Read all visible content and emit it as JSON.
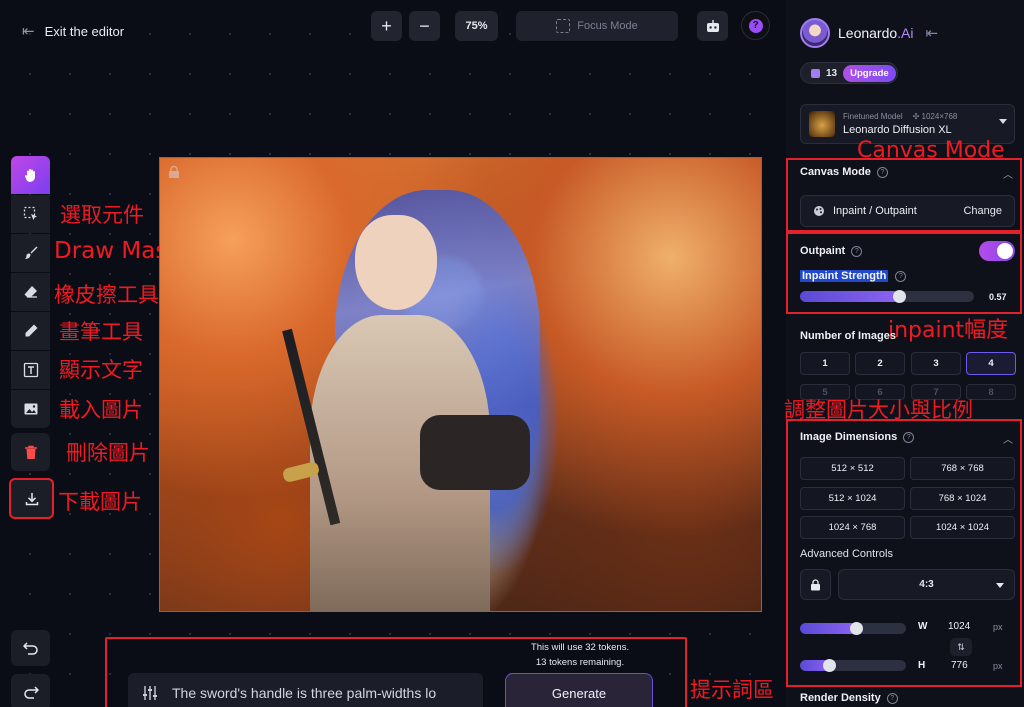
{
  "topbar": {
    "exit_label": "Exit the editor",
    "zoom_in": "+",
    "zoom_out": "−",
    "zoom_level": "75%",
    "focus_mode": "Focus Mode",
    "help": "?"
  },
  "toolbar": {
    "tools": [
      {
        "id": "pan",
        "icon": "hand-icon",
        "active": true,
        "annotation": ""
      },
      {
        "id": "select",
        "icon": "select-icon",
        "annotation": "選取元件"
      },
      {
        "id": "mask",
        "icon": "mask-brush-icon",
        "annotation": "Draw Mask"
      },
      {
        "id": "eraser",
        "icon": "eraser-icon",
        "annotation": "橡皮擦工具"
      },
      {
        "id": "pencil",
        "icon": "pencil-icon",
        "annotation": "畫筆工具"
      },
      {
        "id": "text",
        "icon": "text-icon",
        "annotation": "顯示文字"
      },
      {
        "id": "image",
        "icon": "image-icon",
        "annotation": "載入圖片"
      },
      {
        "id": "delete",
        "icon": "trash-icon",
        "annotation": "刪除圖片"
      },
      {
        "id": "download",
        "icon": "download-icon",
        "annotation": "下載圖片"
      }
    ]
  },
  "prompt": {
    "value": "The sword's handle is three palm-widths lo",
    "tokens_line1": "This will use 32 tokens.",
    "tokens_line2": "13 tokens remaining.",
    "generate_label": "Generate",
    "annotation": "提示詞區"
  },
  "sidebar": {
    "brand": "Leonardo",
    "brand_suffix": ".Ai",
    "credits": "13",
    "upgrade": "Upgrade",
    "model": {
      "tag": "Finetuned Model",
      "resolution": "1024×768",
      "name": "Leonardo Diffusion XL"
    },
    "canvas_mode": {
      "title": "Canvas Mode",
      "value": "Inpaint / Outpaint",
      "change": "Change",
      "annotation": "Canvas Mode"
    },
    "outpaint": {
      "title": "Outpaint",
      "enabled": true,
      "strength_label": "Inpaint Strength",
      "strength_value": "0.57",
      "strength": 0.57,
      "annotation": "inpaint幅度"
    },
    "number_of_images": {
      "title": "Number of Images",
      "options": [
        "1",
        "2",
        "3",
        "4"
      ],
      "ghost_options": [
        "5",
        "6",
        "7",
        "8"
      ],
      "selected": "4"
    },
    "image_dimensions": {
      "title": "Image Dimensions",
      "annotation": "調整圖片大小與比例",
      "options": [
        "512 × 512",
        "768 × 768",
        "512 × 1024",
        "768 × 1024",
        "1024 × 768",
        "1024 × 1024"
      ],
      "advanced_label": "Advanced Controls",
      "ratio": "4:3",
      "width_label": "W",
      "width": "1024",
      "height_label": "H",
      "height": "776",
      "unit": "px",
      "width_fraction": 0.53,
      "height_fraction": 0.28
    },
    "render_density": {
      "title": "Render Density"
    }
  },
  "colors": {
    "accent": "#9b4df6",
    "annotation_red": "#e2212a",
    "panel_bg": "#0f111a"
  }
}
